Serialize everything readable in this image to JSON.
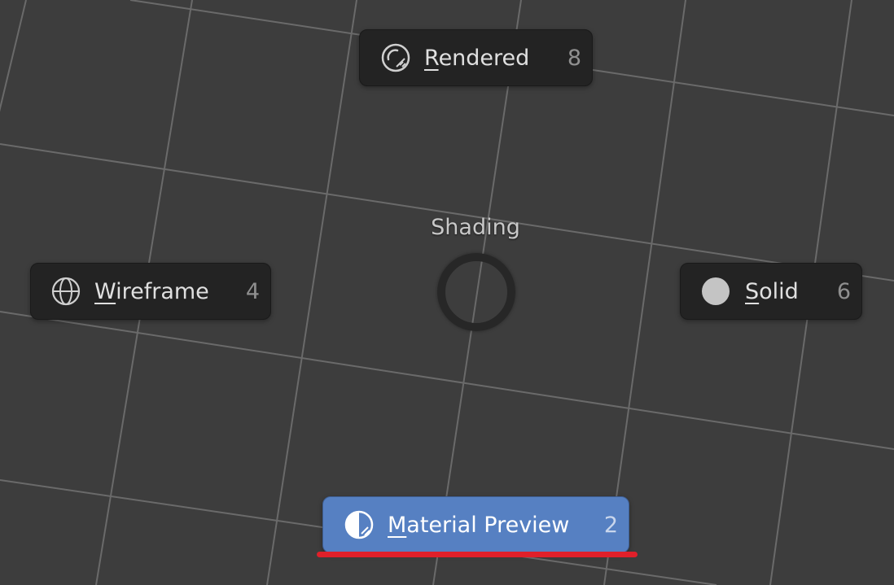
{
  "pie_menu": {
    "title": "Shading",
    "items": [
      {
        "key": "rendered",
        "hotkey_letter": "R",
        "rest": "endered",
        "shortcut": "8",
        "icon": "rendered-shading-icon",
        "active": false
      },
      {
        "key": "wireframe",
        "hotkey_letter": "W",
        "rest": "ireframe",
        "shortcut": "4",
        "icon": "wireframe-globe-icon",
        "active": false
      },
      {
        "key": "solid",
        "hotkey_letter": "S",
        "rest": "olid",
        "shortcut": "6",
        "icon": "solid-sphere-icon",
        "active": false
      },
      {
        "key": "material_preview",
        "hotkey_letter": "M",
        "rest": "aterial Preview",
        "shortcut": "2",
        "icon": "material-preview-icon",
        "active": true
      }
    ]
  },
  "colors": {
    "viewport_background": "#3d3d3d",
    "grid_line": "#6a6a6a",
    "item_background": "#232323",
    "active_item_background": "#5680c2",
    "highlight_underline": "#e0202a"
  }
}
